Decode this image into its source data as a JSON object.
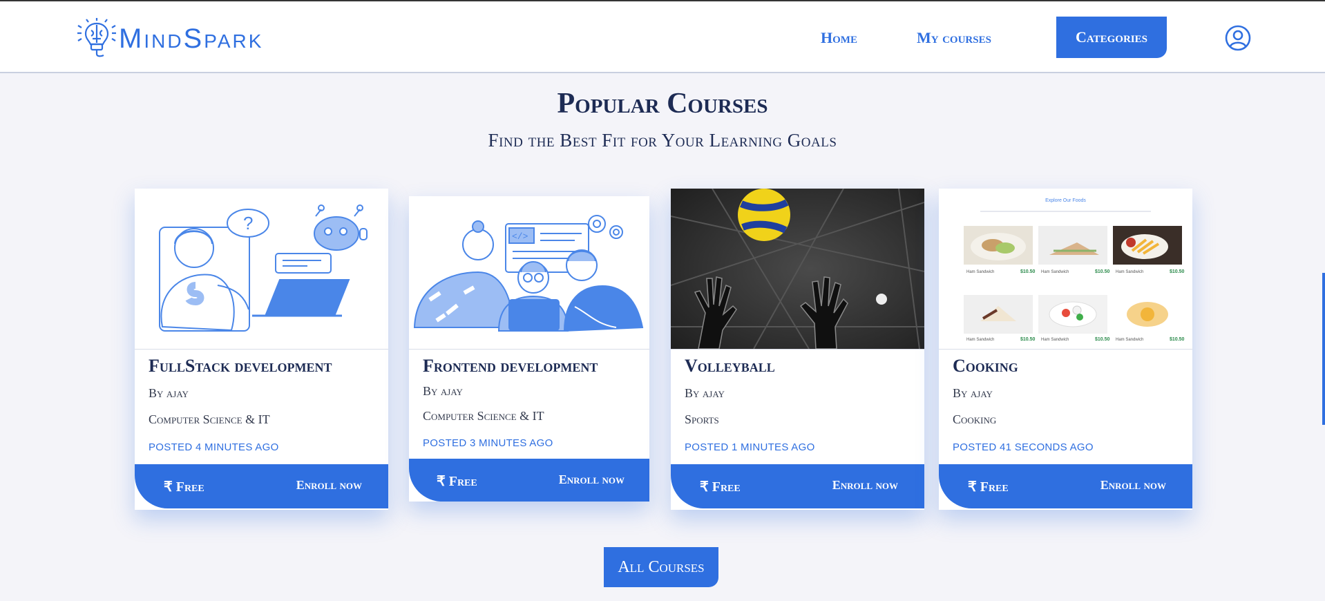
{
  "brand": {
    "name": "MindSpark",
    "color": "#2f6fe0",
    "logo_icon": "bulb-brain-icon"
  },
  "nav": {
    "home": "Home",
    "my_courses": "My courses",
    "categories": "Categories",
    "profile_icon": "user-circle-icon"
  },
  "heading": {
    "title": "Popular Courses",
    "subtitle": "Find the Best Fit for Your Learning Goals"
  },
  "courses": [
    {
      "title": "FullStack development",
      "by": "By ajay",
      "category": "Computer Science & IT",
      "posted": "posted 4 minutes ago",
      "price": "Free",
      "enroll": "Enroll now",
      "image": "illustration-laptop-robot"
    },
    {
      "title": "Frontend development",
      "by": "By ajay",
      "category": "Computer Science & IT",
      "posted": "posted 3 minutes ago",
      "price": "Free",
      "enroll": "Enroll now",
      "image": "illustration-team-laptop"
    },
    {
      "title": "Volleyball",
      "by": "By ajay",
      "category": "Sports",
      "posted": "posted 1 minutes ago",
      "price": "Free",
      "enroll": "Enroll now",
      "image": "photo-volleyball"
    },
    {
      "title": "Cooking",
      "by": "By ajay",
      "category": "Cooking",
      "posted": "posted 41 seconds ago",
      "price": "Free",
      "enroll": "Enroll now",
      "image": "screenshot-food-menu"
    }
  ],
  "food_menu": {
    "heading": "Explore Our Foods",
    "items": [
      {
        "name": "Ham Sandwich",
        "price": "$10.50"
      },
      {
        "name": "Ham Sandwich",
        "price": "$10.50"
      },
      {
        "name": "Ham Sandwich",
        "price": "$10.50"
      },
      {
        "name": "Ham Sandwich",
        "price": "$10.50"
      },
      {
        "name": "Ham Sandwich",
        "price": "$10.50"
      },
      {
        "name": "Ham Sandwich",
        "price": "$10.50"
      }
    ]
  },
  "currency_symbol": "₹",
  "all_courses": "All Courses"
}
